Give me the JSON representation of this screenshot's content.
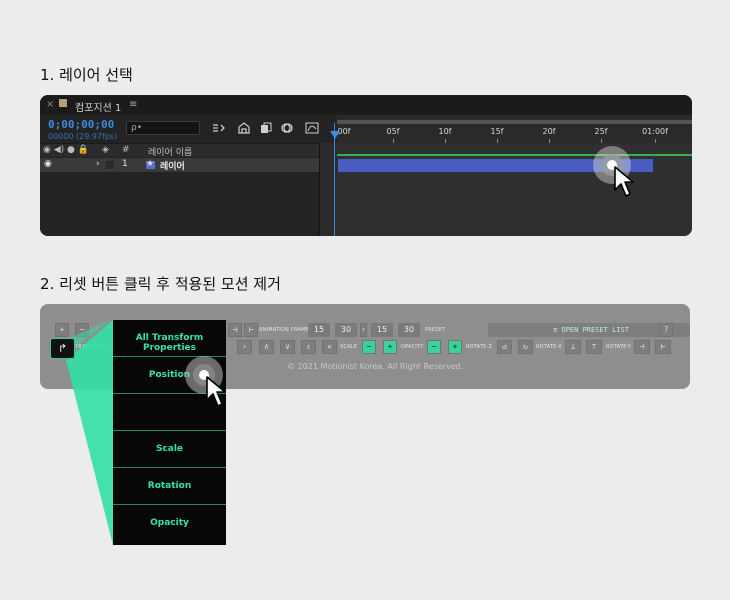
{
  "step1": {
    "title": "1. 레이어 선택"
  },
  "step2": {
    "title": "2. 리셋 버튼 클릭 후 적용된 모션 제거"
  },
  "composition": {
    "tab_close": "×",
    "tab_name": "컴포지션 1",
    "tab_menu": "≡",
    "timecode": "0;00;00;00",
    "fps": "00000 (29.97fps)",
    "search_placeholder": "ρ•",
    "ruler_labels": [
      "00f",
      "05f",
      "10f",
      "15f",
      "20f",
      "25f",
      "01:00f"
    ],
    "column_header": {
      "icons": "◉ ◀) ● 🔒",
      "tag": "◈",
      "hash": "#",
      "layer_name": "레이어 이름"
    },
    "layer": {
      "eye": "◉",
      "chevron": "›",
      "index": "1",
      "star": "★",
      "name": "레이어"
    },
    "colors": {
      "accent": "#3d8ae0",
      "layer_bar": "#4a5bc2",
      "work_area": "#36b04a"
    }
  },
  "plugin": {
    "row1_labels": {
      "animation_frame": "ANIMATION FRAME",
      "preset": "PRESET"
    },
    "row1_values": [
      "15",
      "30",
      "15",
      "30"
    ],
    "open_preset_list": "≡ OPEN PRESET LIST",
    "help": "?",
    "row2_labels": {
      "transform": "TRANSFORM",
      "scale": "SCALE",
      "opacity": "OPACITY",
      "rotate_z": "ROTATE-Z",
      "rotate_x": "ROTATE-X",
      "rotate_y": "ROTATE-Y"
    },
    "copyright": "© 2021 Motionist Korea. All Right Reserved.",
    "reset_icon": "↱",
    "menu_items": [
      "All Transform Properties",
      "Position",
      "",
      "Scale",
      "Rotation",
      "Opacity"
    ],
    "colors": {
      "accent": "#37e3a9",
      "panel": "#8e8e8e"
    }
  }
}
